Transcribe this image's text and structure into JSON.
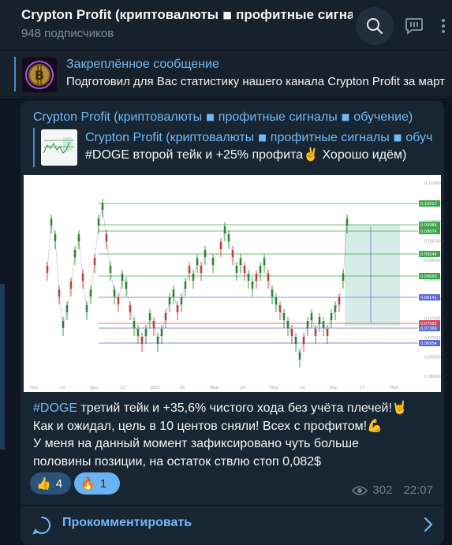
{
  "header": {
    "title": "Crypton Profit (криптовалюты ◾ профитные сигналы ◾ обучение)",
    "subscribers": "948 подписчиков"
  },
  "pinned": {
    "label": "Закреплённое сообщение",
    "text": "Подготовил для Вас статистику нашего канала Crypton Profit за март"
  },
  "message": {
    "author": "Crypton Profit (криптовалюты ◾ профитные сигналы ◾ обучение)",
    "reply": {
      "author": "Crypton Profit (криптовалюты ◾ профитные сигналы ◾ обучение)",
      "text": "#DOGE второй тейк и +25% профита✌️ Хорошо идём)"
    },
    "hashtag": "#DOGE",
    "line1_rest": " третий тейк и +35,6% чистого хода без учёта плечей!🤘",
    "line2": "Как и ожидал, цель в 10 центов сняли! Всех с профитом!💪",
    "line3": "У меня на данный момент зафиксировано чуть больше",
    "line4": "половины позиции, на остаток ствлю стоп 0,082$",
    "reactions": [
      {
        "emoji": "👍",
        "count": "4"
      },
      {
        "emoji": "🔥",
        "count": "1"
      }
    ],
    "views": "302",
    "time": "22:07",
    "comment_label": "Прокомментировать"
  },
  "chart_image": {
    "price_labels": [
      "0.10517",
      "0.09984",
      "0.09874",
      "0.09244",
      "0.08680",
      "0.08141",
      "0.07583",
      "0.07366",
      "0.06954"
    ],
    "axis_labels": [
      "0.11000",
      "0.10500",
      "0.10000",
      "0.09500",
      "0.09000",
      "0.08500",
      "0.08000",
      "0.07500",
      "0.07000",
      "0.06500",
      "0.06000"
    ],
    "time_labels": [
      "Ноя",
      "14",
      "Дек",
      "12",
      "2023",
      "16",
      "Фев",
      "14",
      "Мар",
      "14",
      "Апр",
      "17",
      "Май"
    ]
  },
  "colors": {
    "accent": "#71baf5",
    "bg": "#17212b",
    "bubble": "#182533"
  }
}
